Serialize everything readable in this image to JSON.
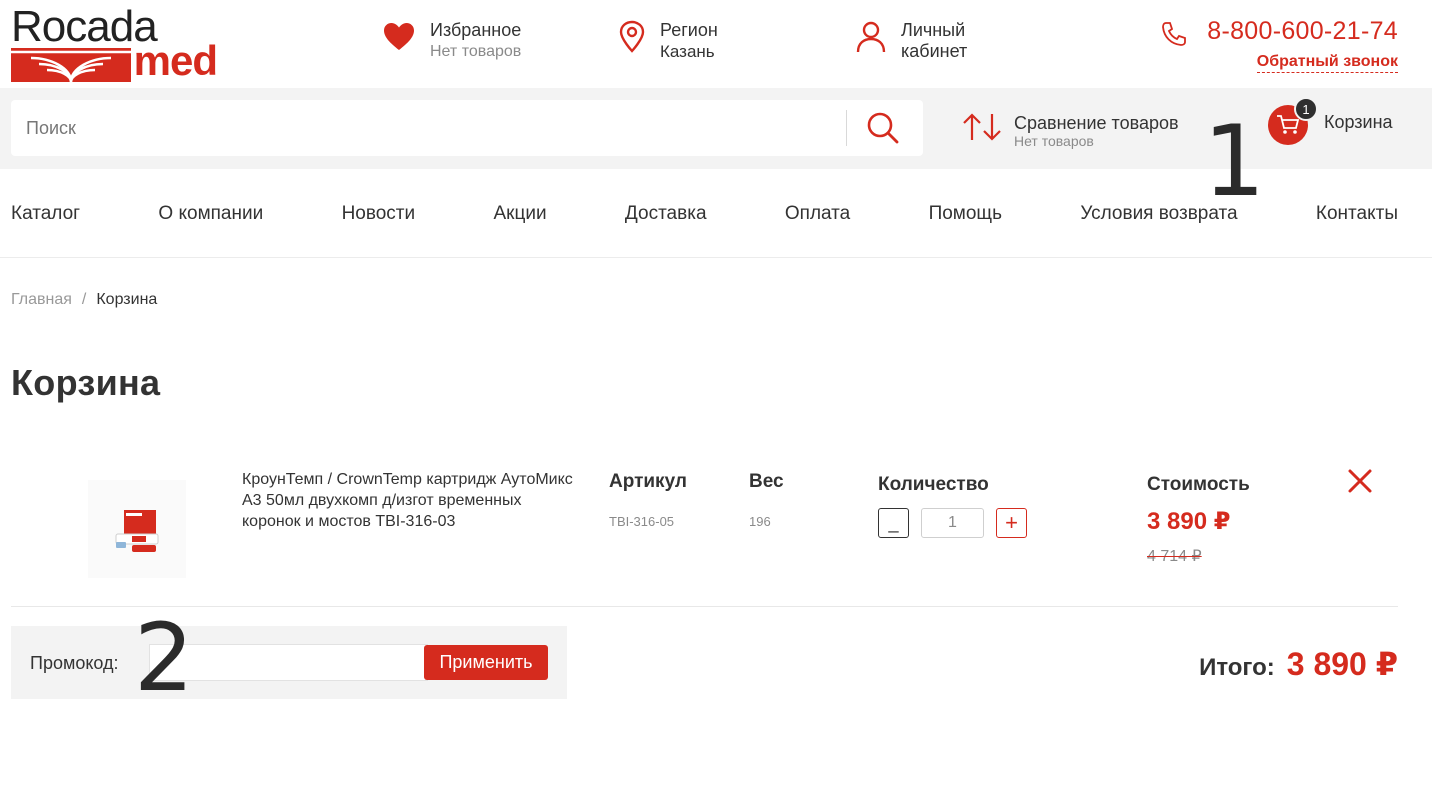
{
  "brand": {
    "top": "Rocada",
    "bottom": "med",
    "accent": "#d52b1e"
  },
  "header": {
    "favorites": {
      "title": "Избранное",
      "subtitle": "Нет товаров",
      "icon": "heart-icon"
    },
    "region": {
      "title": "Регион",
      "subtitle": "Казань",
      "icon": "map-pin-icon"
    },
    "account": {
      "line1": "Личный",
      "line2": "кабинет",
      "icon": "user-icon"
    },
    "phone": {
      "number": "8-800-600-21-74",
      "callback": "Обратный звонок",
      "icon": "phone-icon"
    }
  },
  "search": {
    "placeholder": "Поиск",
    "value": "",
    "icon": "search-icon"
  },
  "compare": {
    "title": "Сравнение товаров",
    "subtitle": "Нет товаров",
    "icon": "sort-arrows-icon"
  },
  "cart": {
    "label": "Корзина",
    "count": "1",
    "icon": "cart-icon"
  },
  "annotations": {
    "one": "1",
    "two": "2"
  },
  "nav": {
    "items": [
      {
        "label": "Каталог"
      },
      {
        "label": "О компании"
      },
      {
        "label": "Новости"
      },
      {
        "label": "Акции"
      },
      {
        "label": "Доставка"
      },
      {
        "label": "Оплата"
      },
      {
        "label": "Помощь"
      },
      {
        "label": "Условия возврата"
      },
      {
        "label": "Контакты"
      }
    ]
  },
  "breadcrumb": {
    "home": "Главная",
    "separator": "/",
    "current": "Корзина"
  },
  "page": {
    "title": "Корзина"
  },
  "item": {
    "name": "КроунТемп / CrownTemp картридж АутоМикс А3 50мл двухкомп д/изгот временных коронок и мостов TBI-316-03",
    "sku_label": "Артикул",
    "sku": "TBI-316-05",
    "weight_label": "Вес",
    "weight": "196",
    "qty_label": "Количество",
    "qty": "1",
    "minus": "_",
    "plus": "+",
    "cost_label": "Стоимость",
    "price": "3 890 ₽",
    "old_price": "4 714 ₽"
  },
  "promo": {
    "label": "Промокод:",
    "value": "",
    "apply": "Применить"
  },
  "total": {
    "label": "Итого:",
    "value": "3 890 ₽"
  }
}
